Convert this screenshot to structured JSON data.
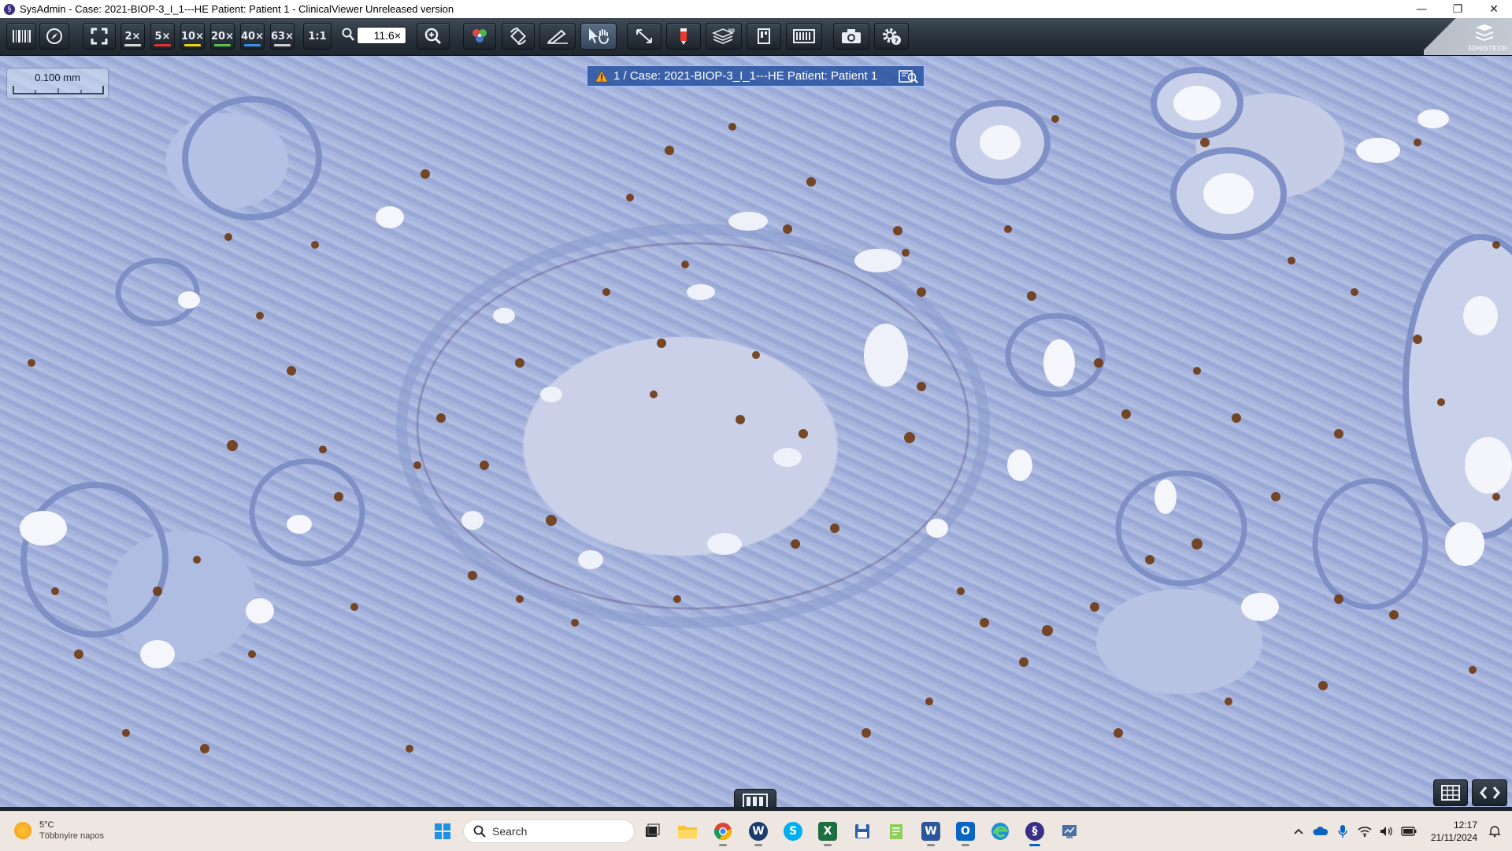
{
  "window": {
    "title": "SysAdmin - Case: 2021-BIOP-3_I_1---HE Patient: Patient 1 - ClinicalViewer Unreleased version",
    "app_icon_glyph": "§",
    "minimize_glyph": "—",
    "maximize_glyph": "❐",
    "close_glyph": "✕"
  },
  "toolbar": {
    "zoom_buttons": [
      {
        "label": "2×",
        "color": "#d8d8d8"
      },
      {
        "label": "5×",
        "color": "#e0332b"
      },
      {
        "label": "10×",
        "color": "#e8d21d"
      },
      {
        "label": "20×",
        "color": "#58c24c"
      },
      {
        "label": "40×",
        "color": "#3b8ee8"
      },
      {
        "label": "63×",
        "color": "#cfcfcf"
      }
    ],
    "one_to_one_label": "1:1",
    "zoom_value": "11.6×",
    "brand_logo_text": "3DHISTECH"
  },
  "viewer": {
    "scale_label": "0.100 mm",
    "case_label": "1 / Case: 2021-BIOP-3_I_1---HE Patient: Patient 1"
  },
  "taskbar": {
    "weather_temp": "5°C",
    "weather_desc": "Többnyire napos",
    "search_placeholder": "Search",
    "time": "12:17",
    "date": "21/11/2024"
  },
  "colors": {
    "stain_background": "#a2b1dc",
    "nuclei_positive": "#6e3a14",
    "accent_taskbar": "#0067c0"
  }
}
